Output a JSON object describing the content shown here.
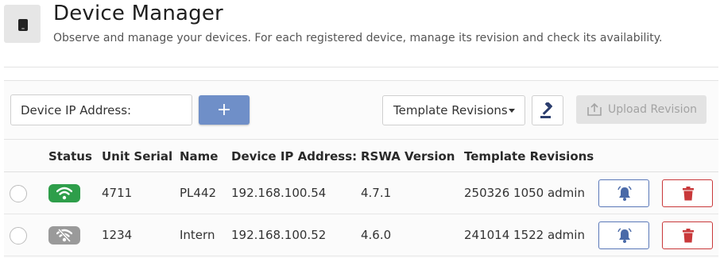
{
  "header": {
    "title": "Device Manager",
    "subtitle": "Observe and manage your devices. For each registered device, manage its revision and check its availability.",
    "icon": "device-icon"
  },
  "toolbar": {
    "ip_placeholder": "Device IP Address:",
    "add_label": "+",
    "template_dropdown_label": "Template Revisions",
    "gavel_icon": "gavel-icon",
    "upload_label": "Upload Revision",
    "upload_icon": "upload-icon"
  },
  "table": {
    "columns": [
      "Status",
      "Unit Serial",
      "Name",
      "Device IP Address:",
      "RSWA Version",
      "Template Revisions"
    ],
    "rows": [
      {
        "status": "online",
        "status_icon": "wifi-icon",
        "serial": "4711",
        "name": "PL442",
        "ip": "192.168.100.54",
        "version": "4.7.1",
        "template": "250326 1050 admin"
      },
      {
        "status": "offline",
        "status_icon": "wifi-off-icon",
        "serial": "1234",
        "name": "Intern",
        "ip": "192.168.100.52",
        "version": "4.6.0",
        "template": "241014 1522 admin"
      }
    ]
  },
  "colors": {
    "primary": "#6f8fc8",
    "online": "#2e9e4a",
    "offline": "#9a9a9a",
    "bell_border": "#5a78b8",
    "danger": "#c9383a",
    "disabled_bg": "#e3e3e3"
  }
}
